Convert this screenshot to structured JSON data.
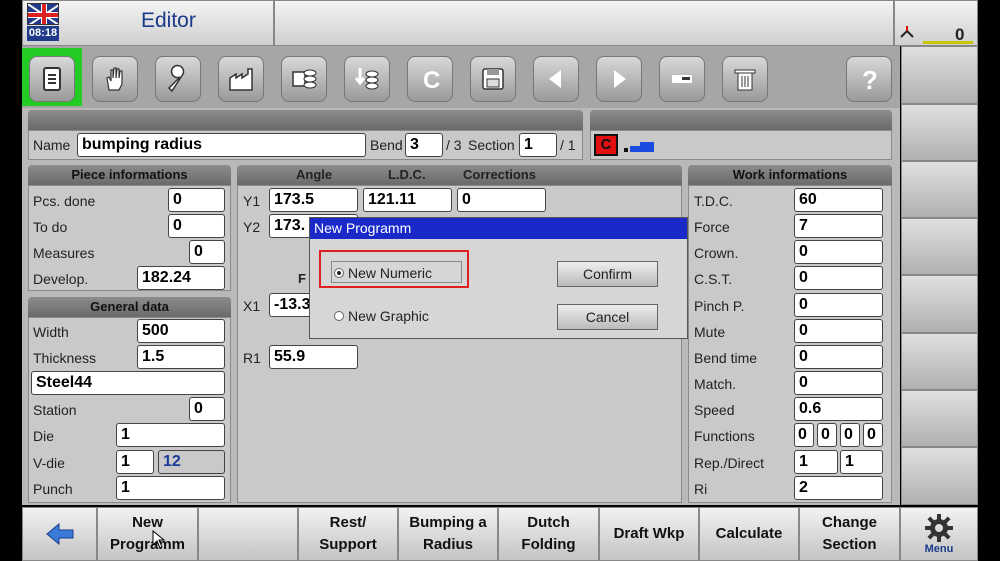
{
  "topbar": {
    "time": "08:18",
    "title": "Editor",
    "counter": "0"
  },
  "program": {
    "name_label": "Name",
    "name_value": "bumping radius",
    "bend_label": "Bend",
    "bend_value": "3",
    "bend_total": "/ 3",
    "section_label": "Section",
    "section_value": "1",
    "section_total": "/ 1",
    "c_badge": "C"
  },
  "piece_info": {
    "header": "Piece informations",
    "rows": [
      {
        "label": "Pcs. done",
        "value": "0"
      },
      {
        "label": "To do",
        "value": "0"
      },
      {
        "label": "Measures",
        "value": "0"
      },
      {
        "label": "Develop.",
        "value": "182.24"
      }
    ]
  },
  "general_data": {
    "header": "General data",
    "width_label": "Width",
    "width_value": "500",
    "thickness_label": "Thickness",
    "thickness_value": "1.5",
    "material": "Steel44",
    "station_label": "Station",
    "station_value": "0",
    "die_label": "Die",
    "die_value": "1",
    "vdie_label": "V-die",
    "vdie_value": "1",
    "vdie_value2": "12",
    "punch_label": "Punch",
    "punch_value": "1"
  },
  "center": {
    "col_angle": "Angle",
    "col_ldc": "L.D.C.",
    "col_corrections": "Corrections",
    "y1_label": "Y1",
    "y1_angle": "173.5",
    "y1_ldc": "121.11",
    "y1_corr": "0",
    "y2_label": "Y2",
    "y2_angle": "173.",
    "f_label": "F",
    "x1_label": "X1",
    "x1_value": "-13.3",
    "r1_label": "R1",
    "r1_value": "55.9"
  },
  "work_info": {
    "header": "Work informations",
    "rows": [
      {
        "label": "T.D.C.",
        "value": "60"
      },
      {
        "label": "Force",
        "value": "7"
      },
      {
        "label": "Crown.",
        "value": "0"
      },
      {
        "label": "C.S.T.",
        "value": "0"
      },
      {
        "label": "Pinch P.",
        "value": "0"
      },
      {
        "label": "Mute",
        "value": "0"
      },
      {
        "label": "Bend time",
        "value": "0"
      },
      {
        "label": "Match.",
        "value": "0"
      },
      {
        "label": "Speed",
        "value": "0.6"
      }
    ],
    "functions_label": "Functions",
    "functions_values": [
      "0",
      "0",
      "0",
      "0"
    ],
    "repdirect_label": "Rep./Direct",
    "rep_value": "1",
    "direct_value": "1",
    "ri_label": "Ri",
    "ri_value": "2"
  },
  "dialog": {
    "title": "New Programm",
    "option_numeric": "New Numeric",
    "option_graphic": "New Graphic",
    "confirm": "Confirm",
    "cancel": "Cancel"
  },
  "softkeys": {
    "new_programm_1": "New",
    "new_programm_2": "Programm",
    "rest_1": "Rest/",
    "rest_2": "Support",
    "bumping_1": "Bumping a",
    "bumping_2": "Radius",
    "dutch_1": "Dutch",
    "dutch_2": "Folding",
    "draft": "Draft Wkp",
    "calculate": "Calculate",
    "change_1": "Change",
    "change_2": "Section",
    "menu": "Menu"
  },
  "colors": {
    "accent_green": "#22cc22",
    "dialog_title": "#1a2ac9",
    "highlight_red": "#e02020",
    "badge_red": "#e01010"
  }
}
